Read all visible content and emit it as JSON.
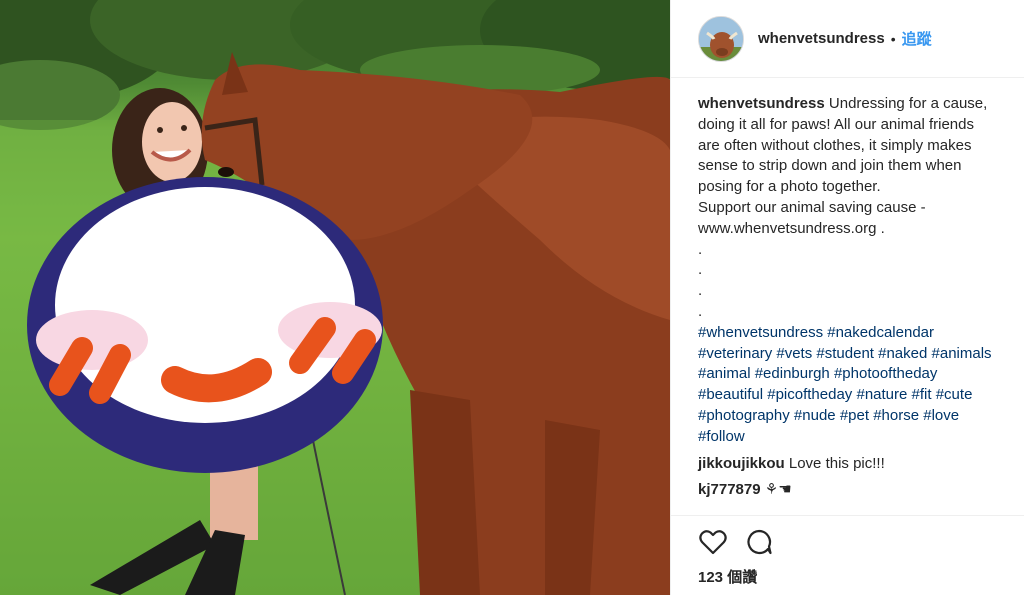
{
  "post": {
    "username": "whenvetsundress",
    "separator": "•",
    "follow_label": "追蹤"
  },
  "caption": {
    "username": "whenvetsundress",
    "lines": [
      "Undressing for a cause,",
      "doing it all for paws! All our animal friends",
      "are often without clothes, it simply makes",
      "sense to strip down and join them when",
      "posing for a photo together.",
      "Support our animal saving cause -",
      "www.whenvetsundress.org ."
    ],
    "dots": [
      ".",
      ".",
      ".",
      "."
    ],
    "hashtag_lines": [
      [
        "#whenvetsundress",
        "#nakedcalendar"
      ],
      [
        "#veterinary",
        "#vets",
        "#student",
        "#naked",
        "#animals"
      ],
      [
        "#animal",
        "#edinburgh",
        "#photooftheday"
      ],
      [
        "#beautiful",
        "#picoftheday",
        "#nature",
        "#fit",
        "#cute"
      ],
      [
        "#photography",
        "#nude",
        "#pet",
        "#horse",
        "#love"
      ],
      [
        "#follow"
      ]
    ]
  },
  "comments": [
    {
      "username": "jikkoujikkou",
      "text": "Love this pic!!!"
    },
    {
      "username": "kj777879",
      "text": "⚘☚"
    }
  ],
  "likes": {
    "label": "123 個讚"
  },
  "icons": {
    "like": "heart-outline-icon",
    "comment": "speech-bubble-icon"
  },
  "colors": {
    "link": "#003569",
    "follow": "#3897f0",
    "sticker_ring": "#2d2a7a",
    "sticker_accent": "#e8531c",
    "sticker_blush": "#f8d7e3"
  }
}
